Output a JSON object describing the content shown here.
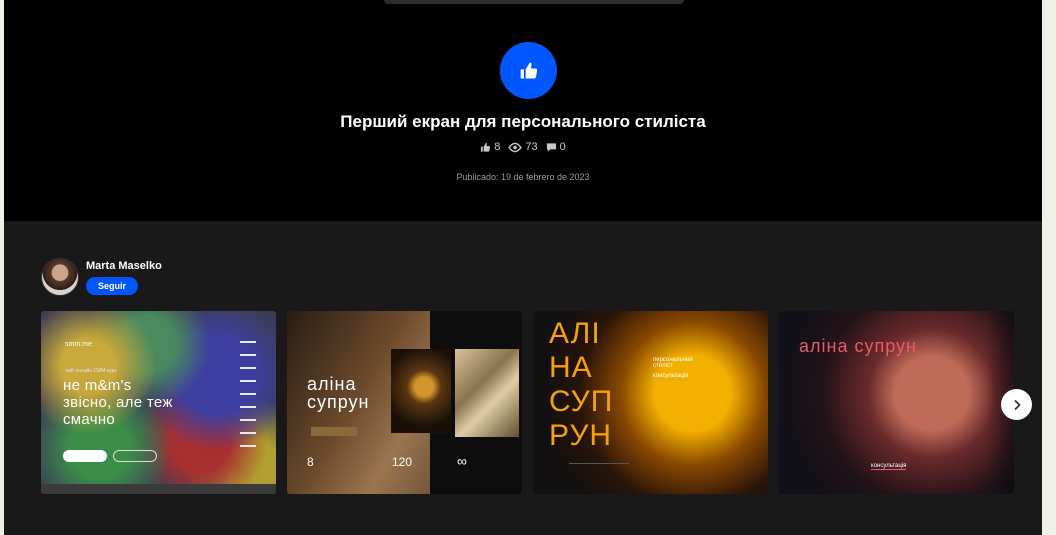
{
  "project": {
    "title": "Перший екран для персонального стиліста",
    "likes": "8",
    "views": "73",
    "comments": "0",
    "published": "Publicado: 19 de febrero de 2023"
  },
  "owner": {
    "name": "Marta Maselko",
    "follow_label": "Seguir"
  },
  "thumbnails": [
    {
      "brand": "smm.me",
      "subtitle": "твій онлайн СММ-курс",
      "headline": "не m&m's звісно, але теж смачно"
    },
    {
      "name": "аліна супрун",
      "stat1": "8",
      "stat2": "120",
      "stat3": "∞"
    },
    {
      "letters": "АЛІ НА СУП РУН",
      "label": "персональний стиліст",
      "button": "консультація"
    },
    {
      "name": "аліна супрун",
      "button": "консультація"
    }
  ],
  "colors": {
    "accent": "#0057ff",
    "hero_bg": "#000000",
    "owner_bg": "#191919"
  },
  "icons": {
    "like": "thumbs-up-icon",
    "view": "eye-icon",
    "comment": "comment-icon",
    "next": "chevron-right-icon"
  }
}
